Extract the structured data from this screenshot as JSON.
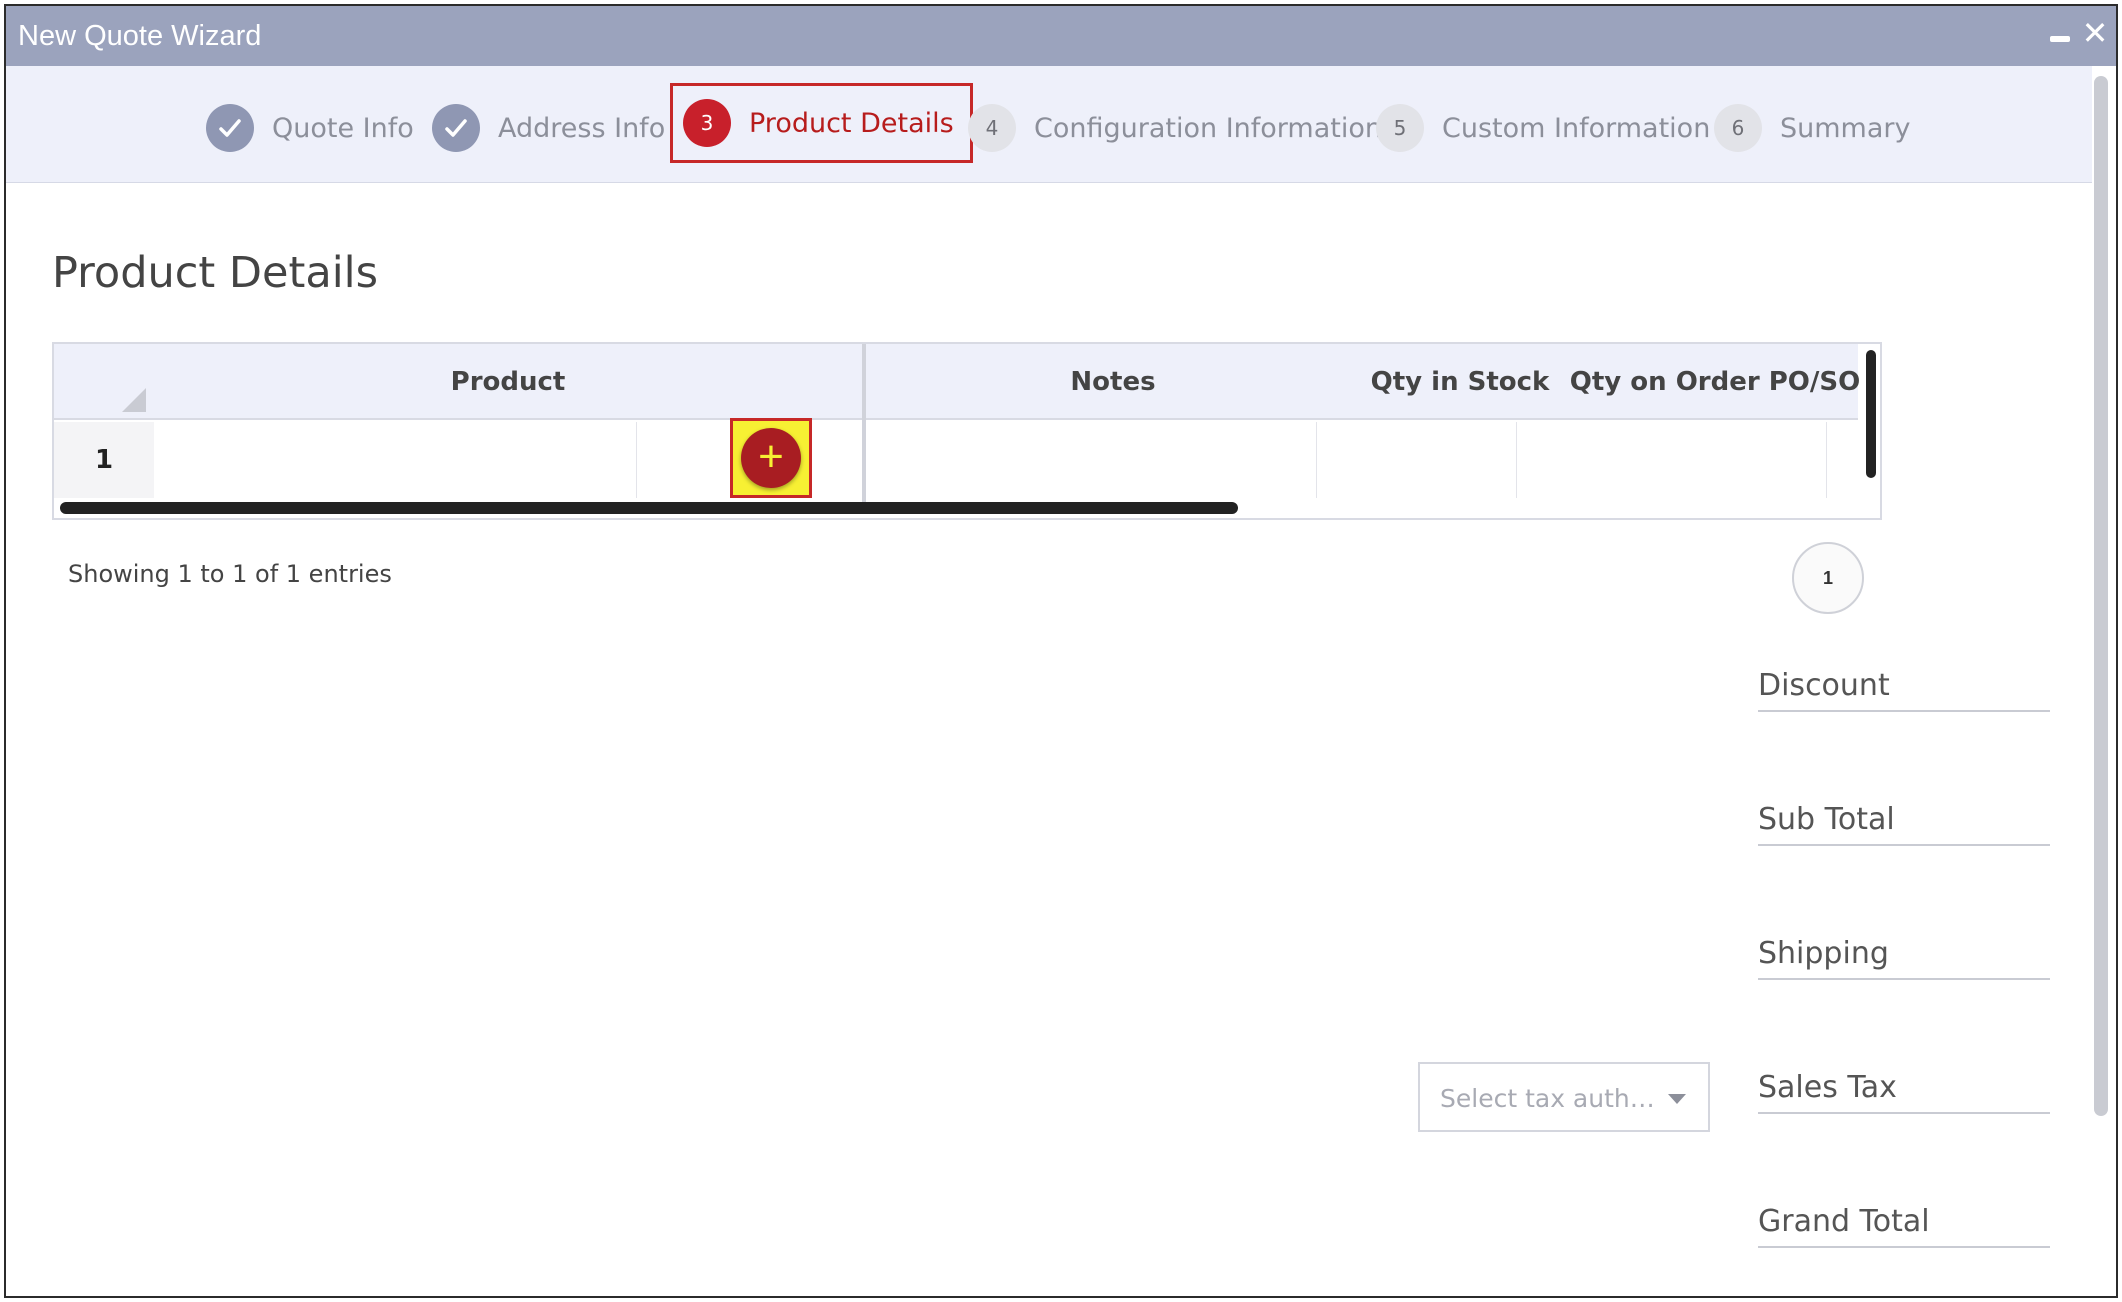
{
  "window": {
    "title": "New Quote Wizard"
  },
  "steps": [
    {
      "number": "",
      "label": "Quote Info",
      "state": "done"
    },
    {
      "number": "",
      "label": "Address Info",
      "state": "done"
    },
    {
      "number": "3",
      "label": "Product Details",
      "state": "active"
    },
    {
      "number": "4",
      "label": "Configuration Information",
      "state": "pending"
    },
    {
      "number": "5",
      "label": "Custom Information",
      "state": "pending"
    },
    {
      "number": "6",
      "label": "Summary",
      "state": "pending"
    }
  ],
  "section": {
    "title": "Product Details"
  },
  "grid": {
    "columns": [
      "Product",
      "Notes",
      "Qty in Stock",
      "Qty on Order PO/SO"
    ],
    "rows": [
      {
        "num": "1",
        "add": "+"
      }
    ]
  },
  "pagination": {
    "entries_text": "Showing 1 to 1 of 1 entries",
    "current_page": "1"
  },
  "totals": {
    "discount": "Discount",
    "sub_total": "Sub Total",
    "shipping": "Shipping",
    "sales_tax": "Sales Tax",
    "grand_total": "Grand Total"
  },
  "tax": {
    "placeholder": "Select tax auth…"
  },
  "colors": {
    "active": "#c8202b",
    "titlebar": "#9ba3bd",
    "stepbar": "#eef0fa",
    "highlight": "#f7f033"
  },
  "icons": {
    "done_step": "check-icon",
    "add": "plus-icon",
    "close": "close-icon",
    "minimize": "minimize-icon"
  }
}
